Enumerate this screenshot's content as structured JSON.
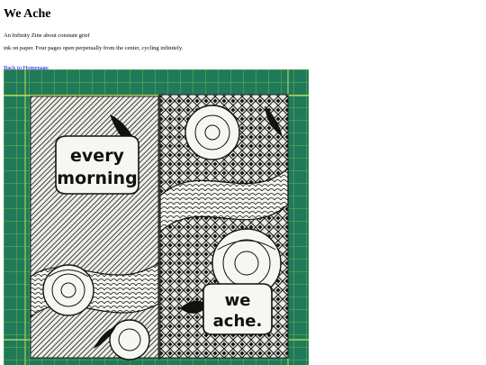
{
  "page": {
    "title": "We Ache",
    "subtitle": "An Infinity Zine about constant grief",
    "description": "ink on paper. Four pages open perpetually from the center, cycling infinitely.",
    "back_link": "Back to Homepage"
  },
  "artwork": {
    "caption_left": [
      "every",
      "morning"
    ],
    "caption_right": [
      "we",
      "ache."
    ],
    "colors": {
      "mat_green": "#1f7a5a",
      "grid_line": "#b9d64a",
      "paper": "#f2f2ee",
      "ink": "#111111"
    }
  }
}
